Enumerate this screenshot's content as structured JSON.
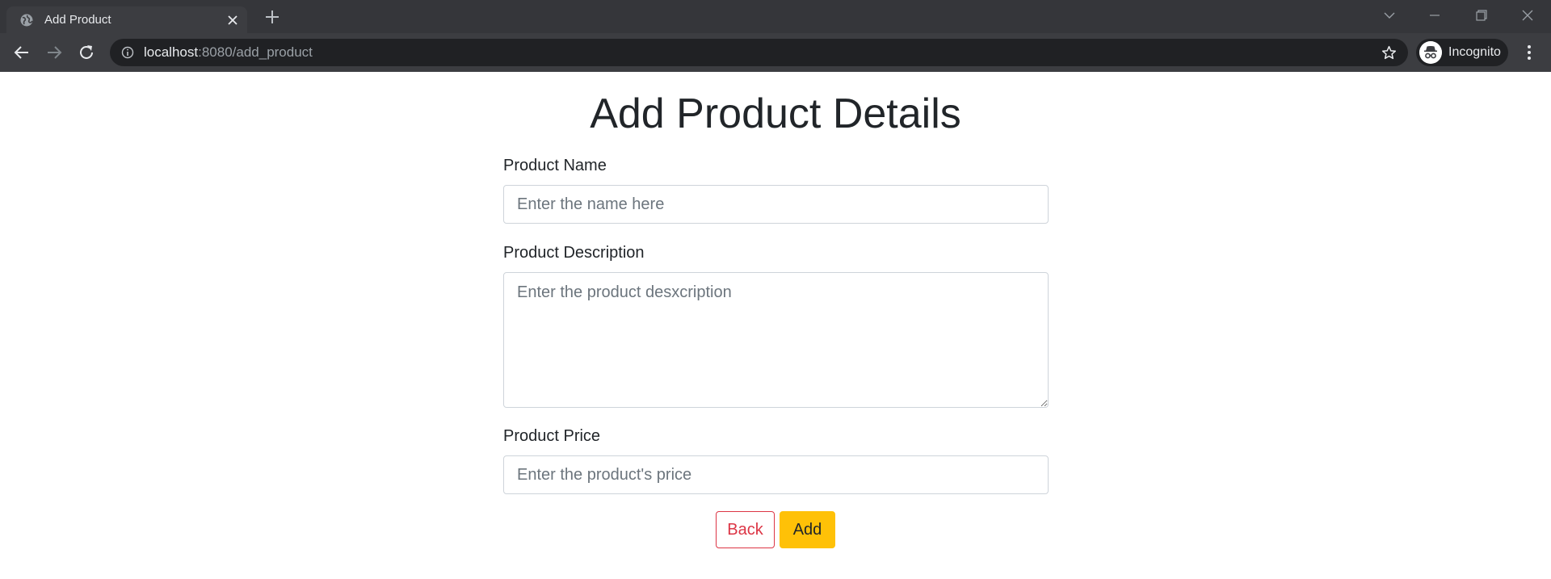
{
  "browser": {
    "tab_title": "Add Product",
    "url_host": "localhost",
    "url_path": ":8080/add_product",
    "profile_label": "Incognito"
  },
  "page": {
    "title": "Add Product Details",
    "fields": {
      "name": {
        "label": "Product Name",
        "placeholder": "Enter the name here",
        "value": ""
      },
      "description": {
        "label": "Product Description",
        "placeholder": "Enter the product desxcription",
        "value": ""
      },
      "price": {
        "label": "Product Price",
        "placeholder": "Enter the product's price",
        "value": ""
      }
    },
    "buttons": {
      "back": "Back",
      "add": "Add"
    }
  },
  "colors": {
    "back_button": "#dc3545",
    "add_button": "#ffc107",
    "chrome_dark": "#35363a",
    "toolbar": "#3c3d41",
    "omnibox": "#202124"
  },
  "icons": {
    "tab_favicon": "globe-icon",
    "tab_close": "close-icon",
    "new_tab": "plus-icon",
    "back": "arrow-left-icon",
    "forward": "arrow-right-icon",
    "reload": "reload-icon",
    "site_info": "info-icon",
    "bookmark": "star-icon",
    "incognito": "incognito-icon",
    "menu": "kebab-menu-icon"
  }
}
